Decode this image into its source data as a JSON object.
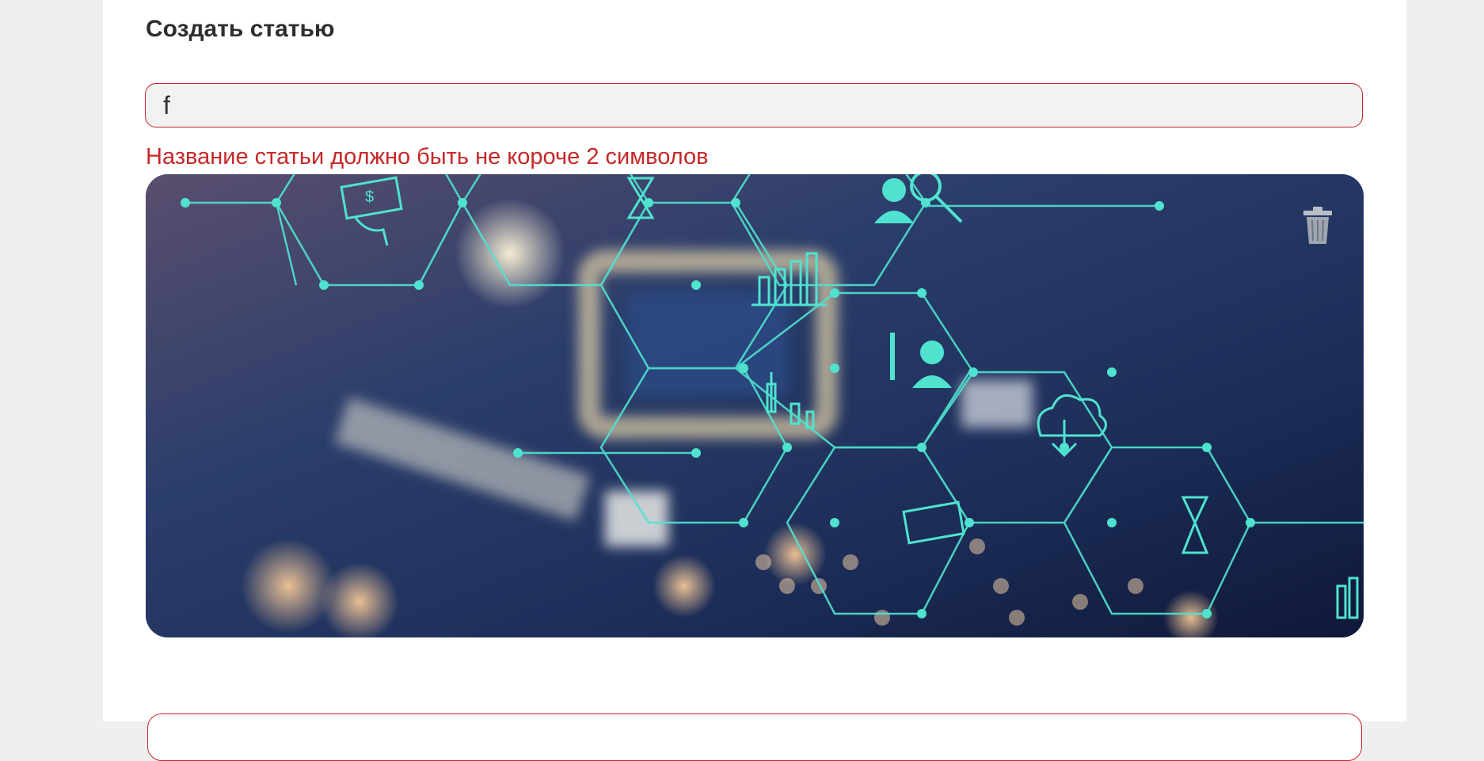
{
  "form": {
    "title": "Создать статью",
    "title_input_value": "f",
    "error_message": "Название статьи должно быть не короче 2 символов"
  },
  "cover": {
    "delete_icon": "trash-icon",
    "accent_color": "#4fe3cf"
  },
  "colors": {
    "error": "#c62828",
    "page_bg": "#efefef",
    "card_bg": "#ffffff"
  }
}
